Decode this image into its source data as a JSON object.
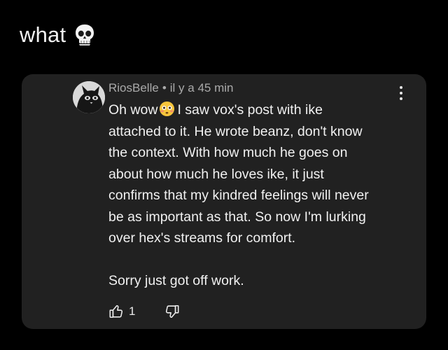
{
  "caption": {
    "text": "what",
    "emoji": "skull-icon"
  },
  "comment": {
    "author": "RiosBelle",
    "separator": "•",
    "time": "il y a 45 min",
    "avatar": "cat-avatar",
    "lines": {
      "l1_before": "Oh wow",
      "l1_emoji": "flushed-face-icon",
      "l1_after": "I saw vox's post with ike",
      "l2": "attached to it. He wrote beanz, don't know",
      "l3": "the context. With how much he goes on",
      "l4": "about how much he loves ike, it just",
      "l5": "confirms that my kindred feelings will never",
      "l6": "be as important as that. So now I'm lurking",
      "l7": "over hex's streams for comfort.",
      "l8": "Sorry just got off work."
    },
    "actions": {
      "like_count": "1",
      "like_icon": "thumbs-up-icon",
      "dislike_icon": "thumbs-down-icon",
      "more_icon": "more-vertical-icon"
    }
  },
  "colors": {
    "background": "#000000",
    "card": "#212121",
    "meta_text": "#aaaaaa",
    "body_text": "#f1f1f1"
  }
}
